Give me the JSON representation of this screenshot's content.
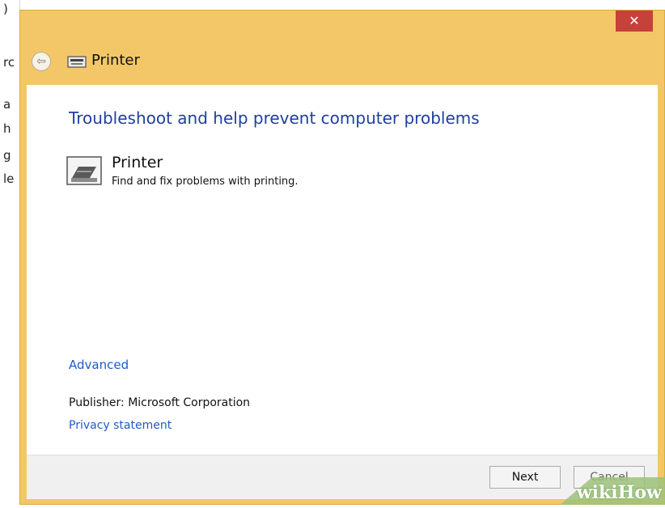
{
  "background_window": {
    "fragments": [
      ")",
      "rc",
      "a",
      "h",
      "g",
      "le"
    ]
  },
  "window": {
    "close_glyph": "✕",
    "back_glyph": "⇦",
    "title": "Printer",
    "icons": {
      "title_icon": "printer-icon",
      "back_icon": "back-arrow-icon"
    },
    "colors": {
      "frame": "#f3c768",
      "close": "#c7413b",
      "heading": "#1e3fa0",
      "link": "#1f5cc8"
    }
  },
  "content": {
    "heading": "Troubleshoot and help prevent computer problems",
    "item": {
      "title": "Printer",
      "description": "Find and fix problems with printing.",
      "icon": "printer-icon"
    },
    "advanced_link": "Advanced",
    "publisher": "Publisher:  Microsoft Corporation",
    "privacy_link": "Privacy statement"
  },
  "footer": {
    "next_label": "Next",
    "cancel_label": "Cancel"
  },
  "watermark": {
    "text": "wikiHow"
  }
}
